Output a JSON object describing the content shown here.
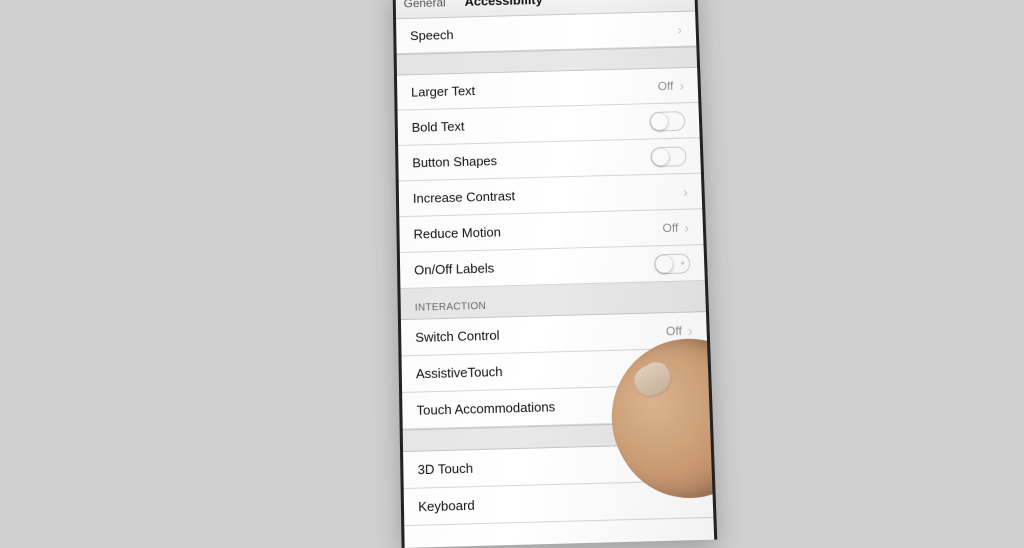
{
  "header": {
    "back": "General",
    "title": "Accessibility"
  },
  "groups": {
    "speech": {
      "label": "Speech"
    },
    "vision": {
      "largerText": {
        "label": "Larger Text",
        "value": "Off"
      },
      "boldText": {
        "label": "Bold Text"
      },
      "buttonShapes": {
        "label": "Button Shapes"
      },
      "increaseContrast": {
        "label": "Increase Contrast"
      },
      "reduceMotion": {
        "label": "Reduce Motion",
        "value": "Off"
      },
      "onOffLabels": {
        "label": "On/Off Labels"
      }
    },
    "interaction": {
      "header": "Interaction",
      "switchControl": {
        "label": "Switch Control",
        "value": "Off"
      },
      "assistiveTouch": {
        "label": "AssistiveTouch"
      },
      "touchAccommodations": {
        "label": "Touch Accommodations"
      },
      "threeDTouch": {
        "label": "3D Touch"
      },
      "keyboard": {
        "label": "Keyboard"
      }
    }
  }
}
